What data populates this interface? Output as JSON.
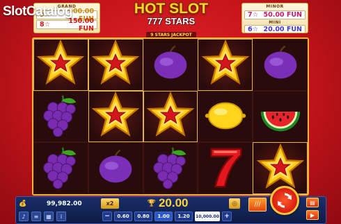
{
  "watermark": "SlotCatalog",
  "jackpots": {
    "grand": {
      "label": "GRAND",
      "count": "9",
      "value": "500.00 FUN"
    },
    "major": {
      "label": "MAJOR",
      "count": "8",
      "value": "150.00 FUN"
    },
    "minor": {
      "label": "MINOR",
      "count": "7",
      "value": "50.00 FUN"
    },
    "mini": {
      "label": "MINI",
      "count": "6",
      "value": "20.00 FUN"
    }
  },
  "logo": {
    "title": "HOT SLOT",
    "subtitle": "777 STARS",
    "jackpot_tag": "9 STARS JACKPOT"
  },
  "reels": [
    [
      "star",
      "star",
      "plum",
      "star",
      "plum"
    ],
    [
      "grapes",
      "star",
      "star",
      "lemon",
      "watermelon"
    ],
    [
      "grapes",
      "plum",
      "grapes",
      "seven",
      "star"
    ]
  ],
  "highlighted": [
    [
      0,
      0
    ],
    [
      0,
      1
    ],
    [
      0,
      3
    ],
    [
      1,
      1
    ],
    [
      1,
      2
    ],
    [
      2,
      4
    ]
  ],
  "bottom": {
    "balance": "99,982.00",
    "multiplier": "x2",
    "bet": "20.00",
    "bet_options": [
      "0.60",
      "0.80",
      "1.00",
      "1.20",
      "10,000.00"
    ],
    "selected_bet": "10,000.00",
    "active_bet": "1.00"
  },
  "colors": {
    "accent": "#ffd23a",
    "bg": "#c3141a",
    "panel": "#1a2e6b"
  }
}
